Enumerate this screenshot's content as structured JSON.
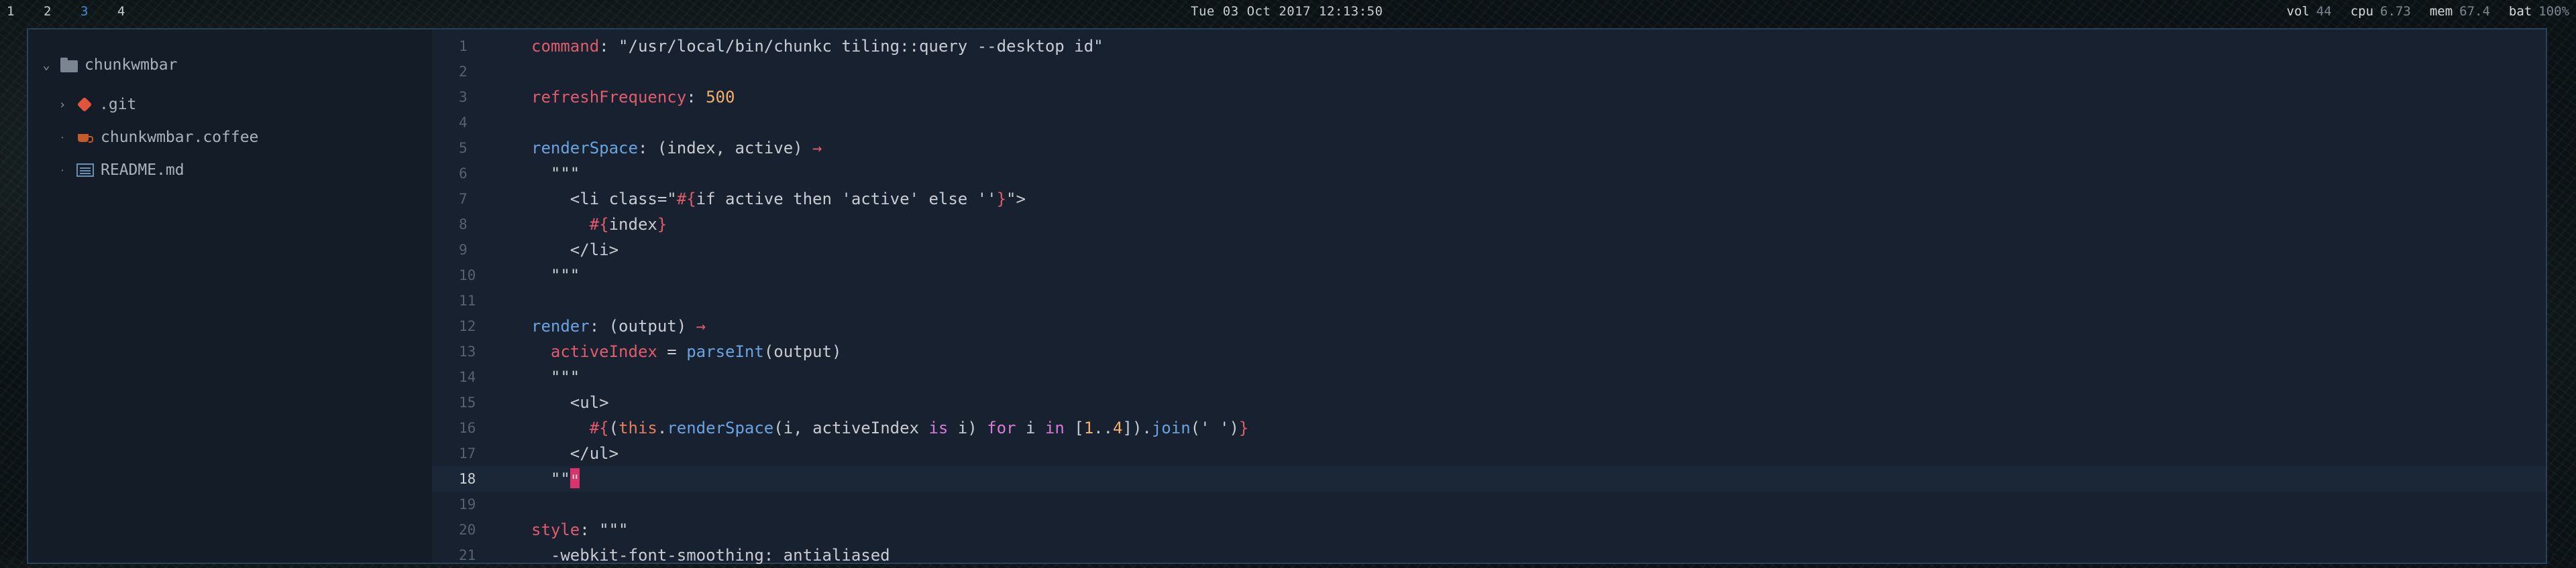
{
  "topbar": {
    "spaces": [
      "1",
      "2",
      "3",
      "4"
    ],
    "active_space": "3",
    "clock": "Tue 03 Oct 2017 12:13:50",
    "stats": [
      {
        "label": "vol",
        "value": "44"
      },
      {
        "label": "cpu",
        "value": "6.73"
      },
      {
        "label": "mem",
        "value": "67.4"
      },
      {
        "label": "bat",
        "value": "100%"
      }
    ]
  },
  "sidebar": {
    "root": "chunkwmbar",
    "items": [
      {
        "name": ".git",
        "icon": "git-folder-icon"
      },
      {
        "name": "chunkwmbar.coffee",
        "icon": "coffee-file-icon"
      },
      {
        "name": "README.md",
        "icon": "markdown-file-icon"
      }
    ]
  },
  "editor": {
    "current_line": 18,
    "lines": [
      {
        "num": "1",
        "tokens": [
          [
            "k-key",
            "command"
          ],
          [
            "k-str",
            ": \"/usr/local/bin/chunkc tiling::query --desktop id\""
          ]
        ]
      },
      {
        "num": "2",
        "tokens": []
      },
      {
        "num": "3",
        "tokens": [
          [
            "k-key",
            "refreshFrequency"
          ],
          [
            "k-str",
            ": "
          ],
          [
            "k-num",
            "500"
          ]
        ]
      },
      {
        "num": "4",
        "tokens": []
      },
      {
        "num": "5",
        "tokens": [
          [
            "k-fn",
            "renderSpace"
          ],
          [
            "k-str",
            ": (index, active) "
          ],
          [
            "k-arrow",
            "→"
          ]
        ]
      },
      {
        "num": "6",
        "tokens": [
          [
            "k-str",
            "  \"\"\""
          ]
        ]
      },
      {
        "num": "7",
        "tokens": [
          [
            "k-str",
            "    <li class=\""
          ],
          [
            "k-interp",
            "#{"
          ],
          [
            "k-str",
            "if active then 'active' else ''"
          ],
          [
            "k-interp",
            "}"
          ],
          [
            "k-str",
            "\">"
          ]
        ]
      },
      {
        "num": "8",
        "tokens": [
          [
            "k-str",
            "      "
          ],
          [
            "k-interp",
            "#{"
          ],
          [
            "k-str",
            "index"
          ],
          [
            "k-interp",
            "}"
          ]
        ]
      },
      {
        "num": "9",
        "tokens": [
          [
            "k-str",
            "    </li>"
          ]
        ]
      },
      {
        "num": "10",
        "tokens": [
          [
            "k-str",
            "  \"\"\""
          ]
        ]
      },
      {
        "num": "11",
        "tokens": []
      },
      {
        "num": "12",
        "tokens": [
          [
            "k-fn",
            "render"
          ],
          [
            "k-str",
            ": (output) "
          ],
          [
            "k-arrow",
            "→"
          ]
        ]
      },
      {
        "num": "13",
        "tokens": [
          [
            "k-str",
            "  "
          ],
          [
            "k-key",
            "activeIndex"
          ],
          [
            "k-str",
            " = "
          ],
          [
            "k-method",
            "parseInt"
          ],
          [
            "k-str",
            "(output)"
          ]
        ]
      },
      {
        "num": "14",
        "tokens": [
          [
            "k-str",
            "  \"\"\""
          ]
        ]
      },
      {
        "num": "15",
        "tokens": [
          [
            "k-str",
            "    <ul>"
          ]
        ]
      },
      {
        "num": "16",
        "tokens": [
          [
            "k-str",
            "      "
          ],
          [
            "k-interp",
            "#{"
          ],
          [
            "k-str",
            "("
          ],
          [
            "k-this",
            "this"
          ],
          [
            "k-str",
            "."
          ],
          [
            "k-method",
            "renderSpace"
          ],
          [
            "k-str",
            "(i, activeIndex "
          ],
          [
            "k-kw",
            "is"
          ],
          [
            "k-str",
            " i) "
          ],
          [
            "k-kw",
            "for"
          ],
          [
            "k-str",
            " i "
          ],
          [
            "k-kw",
            "in"
          ],
          [
            "k-str",
            " ["
          ],
          [
            "k-num",
            "1"
          ],
          [
            "k-str",
            ".."
          ],
          [
            "k-num",
            "4"
          ],
          [
            "k-str",
            "])."
          ],
          [
            "k-method",
            "join"
          ],
          [
            "k-str",
            "(' ')"
          ],
          [
            "k-interp",
            "}"
          ]
        ]
      },
      {
        "num": "17",
        "tokens": [
          [
            "k-str",
            "    </ul>"
          ]
        ]
      },
      {
        "num": "18",
        "tokens": [
          [
            "k-str",
            "  \"\""
          ],
          [
            "cursor",
            "\""
          ]
        ]
      },
      {
        "num": "19",
        "tokens": []
      },
      {
        "num": "20",
        "tokens": [
          [
            "k-key",
            "style"
          ],
          [
            "k-str",
            ": \"\"\""
          ]
        ]
      },
      {
        "num": "21",
        "tokens": [
          [
            "k-str",
            "  -webkit-font-smoothing: antialiased"
          ]
        ]
      }
    ]
  }
}
